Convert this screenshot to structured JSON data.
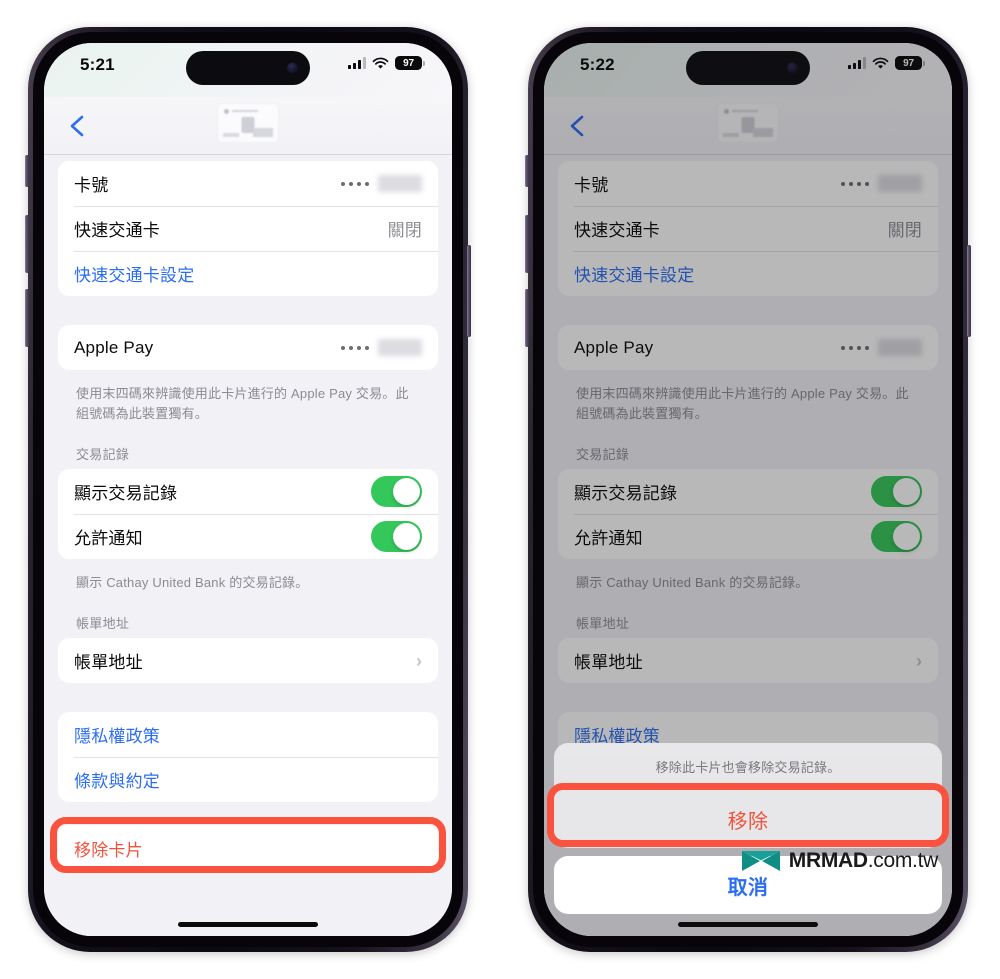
{
  "page": {
    "background": "#ffffff",
    "accent_blue": "#2b6ef0",
    "accent_red": "#f0523c",
    "highlight_red": "#f9533f",
    "toggle_green": "#34c759"
  },
  "watermark": {
    "brand": "MRMAD",
    "suffix": ".com.tw",
    "logo_color": "#0f8f84"
  },
  "phones": [
    {
      "id": "left",
      "status_bar": {
        "time": "5:21",
        "battery": "97",
        "signal_icon": "cellular-bars-icon",
        "wifi_icon": "wifi-icon",
        "battery_icon": "battery-icon"
      },
      "nav": {
        "back_icon": "chevron-left-icon",
        "card_thumbnail": "card-thumbnail"
      },
      "sections": [
        {
          "rows": [
            {
              "label": "卡號",
              "value_type": "masked",
              "dots": 4
            },
            {
              "label": "快速交通卡",
              "value": "關閉"
            },
            {
              "label": "快速交通卡設定",
              "style": "blue"
            }
          ]
        },
        {
          "rows": [
            {
              "label": "Apple Pay",
              "value_type": "masked",
              "dots": 4
            }
          ],
          "footnote": "使用末四碼來辨識使用此卡片進行的 Apple Pay 交易。此組號碼為此裝置獨有。"
        },
        {
          "header": "交易記錄",
          "rows": [
            {
              "label": "顯示交易記錄",
              "value_type": "toggle",
              "toggle_on": true
            },
            {
              "label": "允許通知",
              "value_type": "toggle",
              "toggle_on": true
            }
          ],
          "footnote": "顯示 Cathay United Bank 的交易記錄。"
        },
        {
          "header": "帳單地址",
          "rows": [
            {
              "label": "帳單地址",
              "value_type": "chevron"
            }
          ]
        },
        {
          "rows": [
            {
              "label": "隱私權政策",
              "style": "blue"
            },
            {
              "label": "條款與約定",
              "style": "blue"
            }
          ]
        },
        {
          "rows": [
            {
              "label": "移除卡片",
              "style": "red",
              "highlighted": true
            }
          ]
        }
      ]
    },
    {
      "id": "right",
      "dimmed": true,
      "status_bar": {
        "time": "5:22",
        "battery": "97",
        "signal_icon": "cellular-bars-icon",
        "wifi_icon": "wifi-icon",
        "battery_icon": "battery-icon"
      },
      "nav": {
        "back_icon": "chevron-left-icon",
        "card_thumbnail": "card-thumbnail"
      },
      "sections": [
        {
          "rows": [
            {
              "label": "卡號",
              "value_type": "masked",
              "dots": 4
            },
            {
              "label": "快速交通卡",
              "value": "關閉"
            },
            {
              "label": "快速交通卡設定",
              "style": "blue"
            }
          ]
        },
        {
          "rows": [
            {
              "label": "Apple Pay",
              "value_type": "masked",
              "dots": 4
            }
          ],
          "footnote": "使用末四碼來辨識使用此卡片進行的 Apple Pay 交易。此組號碼為此裝置獨有。"
        },
        {
          "header": "交易記錄",
          "rows": [
            {
              "label": "顯示交易記錄",
              "value_type": "toggle",
              "toggle_on": true
            },
            {
              "label": "允許通知",
              "value_type": "toggle",
              "toggle_on": true
            }
          ],
          "footnote": "顯示 Cathay United Bank 的交易記錄。"
        },
        {
          "header": "帳單地址",
          "rows": [
            {
              "label": "帳單地址",
              "value_type": "chevron"
            }
          ]
        },
        {
          "rows": [
            {
              "label": "隱私權政策",
              "style": "blue"
            }
          ]
        }
      ],
      "action_sheet": {
        "message": "移除此卡片也會移除交易記錄。",
        "destructive_label": "移除",
        "destructive_highlighted": true,
        "cancel_label": "取消"
      }
    }
  ]
}
